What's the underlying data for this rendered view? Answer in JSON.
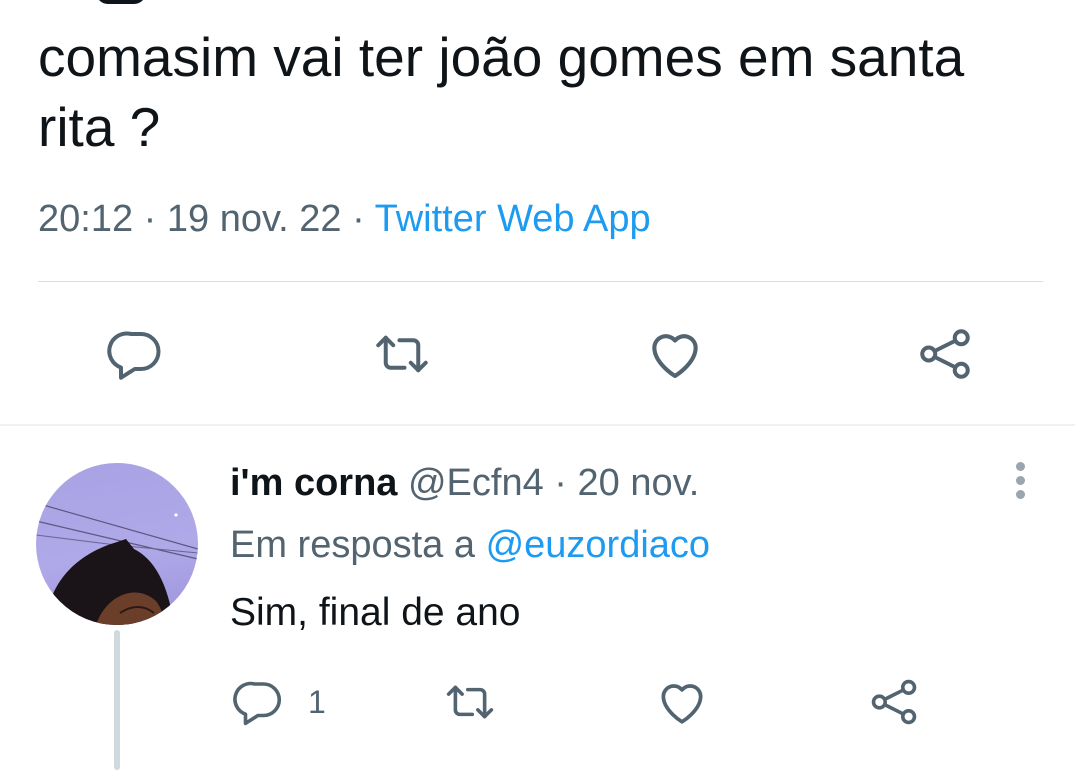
{
  "tweet": {
    "text": "comasim vai ter joão gomes em santa rita ?",
    "time": "20:12",
    "date": "19 nov. 22",
    "separator": "·",
    "source": "Twitter Web App"
  },
  "actions": {
    "reply_icon": "reply-icon",
    "retweet_icon": "retweet-icon",
    "like_icon": "heart-icon",
    "share_icon": "share-icon"
  },
  "reply": {
    "display_name": "i'm corna",
    "handle": "@Ecfn4",
    "separator": "·",
    "date": "20 nov.",
    "in_reply_to_label": "Em resposta a",
    "in_reply_to_handle": "@euzordiaco",
    "text": "Sim, final de ano",
    "reply_count": "1"
  },
  "colors": {
    "text": "#0f1419",
    "secondary": "#536471",
    "accent": "#1d9bf0",
    "divider": "#eff3f4"
  }
}
